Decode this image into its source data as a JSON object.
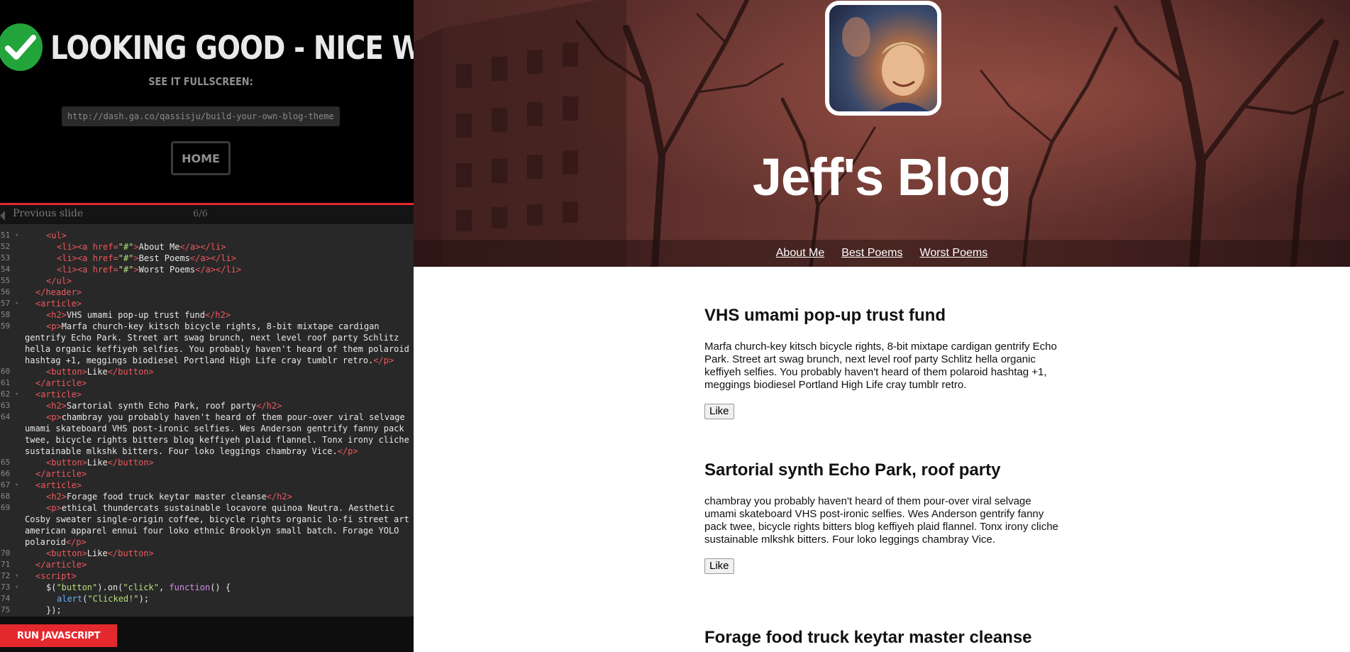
{
  "success_panel": {
    "title": "LOOKING GOOD - NICE WORK!",
    "fullscreen_label": "SEE IT FULLSCREEN:",
    "url": "http://dash.ga.co/qassisju/build-your-own-blog-theme",
    "home_label": "HOME"
  },
  "slide_nav": {
    "previous_label": "Previous slide",
    "counter": "6/6"
  },
  "run_button": "RUN JAVASCRIPT",
  "code_lines": [
    {
      "ln": "51",
      "fold": true,
      "html": "<span class='tag'>&lt;ul&gt;</span>",
      "indent": 2
    },
    {
      "ln": "52",
      "fold": false,
      "html": "<span class='tag'>&lt;li&gt;&lt;a</span> <span class='tag'>href=</span><span class='str'>\"#\"</span><span class='tag'>&gt;</span><span class='txt'>About Me</span><span class='tag'>&lt;/a&gt;&lt;/li&gt;</span>",
      "indent": 3
    },
    {
      "ln": "53",
      "fold": false,
      "html": "<span class='tag'>&lt;li&gt;&lt;a</span> <span class='tag'>href=</span><span class='str'>\"#\"</span><span class='tag'>&gt;</span><span class='txt'>Best Poems</span><span class='tag'>&lt;/a&gt;&lt;/li&gt;</span>",
      "indent": 3
    },
    {
      "ln": "54",
      "fold": false,
      "html": "<span class='tag'>&lt;li&gt;&lt;a</span> <span class='tag'>href=</span><span class='str'>\"#\"</span><span class='tag'>&gt;</span><span class='txt'>Worst Poems</span><span class='tag'>&lt;/a&gt;&lt;/li&gt;</span>",
      "indent": 3
    },
    {
      "ln": "55",
      "fold": false,
      "html": "<span class='tag'>&lt;/ul&gt;</span>",
      "indent": 2
    },
    {
      "ln": "56",
      "fold": false,
      "html": "<span class='tag'>&lt;/header&gt;</span>",
      "indent": 1
    },
    {
      "ln": "57",
      "fold": true,
      "html": "<span class='tag'>&lt;article&gt;</span>",
      "indent": 1
    },
    {
      "ln": "58",
      "fold": false,
      "html": "<span class='tag'>&lt;h2&gt;</span><span class='txt'>VHS umami pop-up trust fund</span><span class='tag'>&lt;/h2&gt;</span>",
      "indent": 2
    },
    {
      "ln": "59",
      "fold": false,
      "html": "<span class='tag'>&lt;p&gt;</span><span class='txt'>Marfa church-key kitsch bicycle rights, 8-bit mixtape cardigan</span>",
      "indent": 2
    },
    {
      "ln": "",
      "fold": false,
      "html": "<span class='txt'>gentrify Echo Park. Street art swag brunch, next level roof party Schlitz</span>",
      "indent": 0
    },
    {
      "ln": "",
      "fold": false,
      "html": "<span class='txt'>hella organic keffiyeh selfies. You probably haven't heard of them polaroid</span>",
      "indent": 0
    },
    {
      "ln": "",
      "fold": false,
      "html": "<span class='txt'>hashtag +1, meggings biodiesel Portland High Life cray tumblr retro.</span><span class='tag'>&lt;/p&gt;</span>",
      "indent": 0
    },
    {
      "ln": "60",
      "fold": false,
      "html": "<span class='tag'>&lt;button&gt;</span><span class='txt'>Like</span><span class='tag'>&lt;/button&gt;</span>",
      "indent": 2
    },
    {
      "ln": "61",
      "fold": false,
      "html": "<span class='tag'>&lt;/article&gt;</span>",
      "indent": 1
    },
    {
      "ln": "62",
      "fold": true,
      "html": "<span class='tag'>&lt;article&gt;</span>",
      "indent": 1
    },
    {
      "ln": "63",
      "fold": false,
      "html": "<span class='tag'>&lt;h2&gt;</span><span class='txt'>Sartorial synth Echo Park, roof party</span><span class='tag'>&lt;/h2&gt;</span>",
      "indent": 2
    },
    {
      "ln": "64",
      "fold": false,
      "html": "<span class='tag'>&lt;p&gt;</span><span class='txt'>chambray you probably haven't heard of them pour-over viral selvage</span>",
      "indent": 2
    },
    {
      "ln": "",
      "fold": false,
      "html": "<span class='txt'>umami skateboard VHS post-ironic selfies. Wes Anderson gentrify fanny pack</span>",
      "indent": 0
    },
    {
      "ln": "",
      "fold": false,
      "html": "<span class='txt'>twee, bicycle rights bitters blog keffiyeh plaid flannel. Tonx irony cliche</span>",
      "indent": 0
    },
    {
      "ln": "",
      "fold": false,
      "html": "<span class='txt'>sustainable mlkshk bitters. Four loko leggings chambray Vice.</span><span class='tag'>&lt;/p&gt;</span>",
      "indent": 0
    },
    {
      "ln": "65",
      "fold": false,
      "html": "<span class='tag'>&lt;button&gt;</span><span class='txt'>Like</span><span class='tag'>&lt;/button&gt;</span>",
      "indent": 2
    },
    {
      "ln": "66",
      "fold": false,
      "html": "<span class='tag'>&lt;/article&gt;</span>",
      "indent": 1
    },
    {
      "ln": "67",
      "fold": true,
      "html": "<span class='tag'>&lt;article&gt;</span>",
      "indent": 1
    },
    {
      "ln": "68",
      "fold": false,
      "html": "<span class='tag'>&lt;h2&gt;</span><span class='txt'>Forage food truck keytar master cleanse</span><span class='tag'>&lt;/h2&gt;</span>",
      "indent": 2
    },
    {
      "ln": "69",
      "fold": false,
      "html": "<span class='tag'>&lt;p&gt;</span><span class='txt'>ethical thundercats sustainable locavore quinoa Neutra. Aesthetic</span>",
      "indent": 2
    },
    {
      "ln": "",
      "fold": false,
      "html": "<span class='txt'>Cosby sweater single-origin coffee, bicycle rights organic lo-fi street art</span>",
      "indent": 0
    },
    {
      "ln": "",
      "fold": false,
      "html": "<span class='txt'>american apparel ennui four loko ethnic Brooklyn small batch. Forage YOLO</span>",
      "indent": 0
    },
    {
      "ln": "",
      "fold": false,
      "html": "<span class='txt'>polaroid</span><span class='tag'>&lt;/p&gt;</span>",
      "indent": 0
    },
    {
      "ln": "70",
      "fold": false,
      "html": "<span class='tag'>&lt;button&gt;</span><span class='txt'>Like</span><span class='tag'>&lt;/button&gt;</span>",
      "indent": 2
    },
    {
      "ln": "71",
      "fold": false,
      "html": "<span class='tag'>&lt;/article&gt;</span>",
      "indent": 1
    },
    {
      "ln": "72",
      "fold": true,
      "html": "<span class='tag'>&lt;script&gt;</span>",
      "indent": 1
    },
    {
      "ln": "73",
      "fold": true,
      "html": "<span class='txt'>$(</span><span class='str'>\"button\"</span><span class='txt'>).on(</span><span class='str'>\"click\"</span><span class='txt'>, </span><span class='kw'>function</span><span class='txt'>() {</span>",
      "indent": 2
    },
    {
      "ln": "74",
      "fold": false,
      "html": "<span class='fn'>alert</span><span class='txt'>(</span><span class='str'>\"Clicked!\"</span><span class='txt'>);</span>",
      "indent": 3
    },
    {
      "ln": "75",
      "fold": false,
      "html": "<span class='txt'>});</span>",
      "indent": 2
    }
  ],
  "blog": {
    "title": "Jeff's Blog",
    "nav": [
      "About Me",
      "Best Poems",
      "Worst Poems"
    ],
    "articles": [
      {
        "heading": "VHS umami pop-up trust fund",
        "body": "Marfa church-key kitsch bicycle rights, 8-bit mixtape cardigan gentrify Echo Park. Street art swag brunch, next level roof party Schlitz hella organic keffiyeh selfies. You probably haven't heard of them polaroid hashtag +1, meggings biodiesel Portland High Life cray tumblr retro.",
        "button": "Like"
      },
      {
        "heading": "Sartorial synth Echo Park, roof party",
        "body": "chambray you probably haven't heard of them pour-over viral selvage umami skateboard VHS post-ironic selfies. Wes Anderson gentrify fanny pack twee, bicycle rights bitters blog keffiyeh plaid flannel. Tonx irony cliche sustainable mlkshk bitters. Four loko leggings chambray Vice.",
        "button": "Like"
      },
      {
        "heading": "Forage food truck keytar master cleanse",
        "body": "",
        "button": ""
      }
    ]
  },
  "colors": {
    "accent_red": "#e4292e",
    "check_green": "#22a43a",
    "editor_bg": "#282828",
    "tag_red": "#f0585e",
    "string_green": "#b7e07c"
  }
}
